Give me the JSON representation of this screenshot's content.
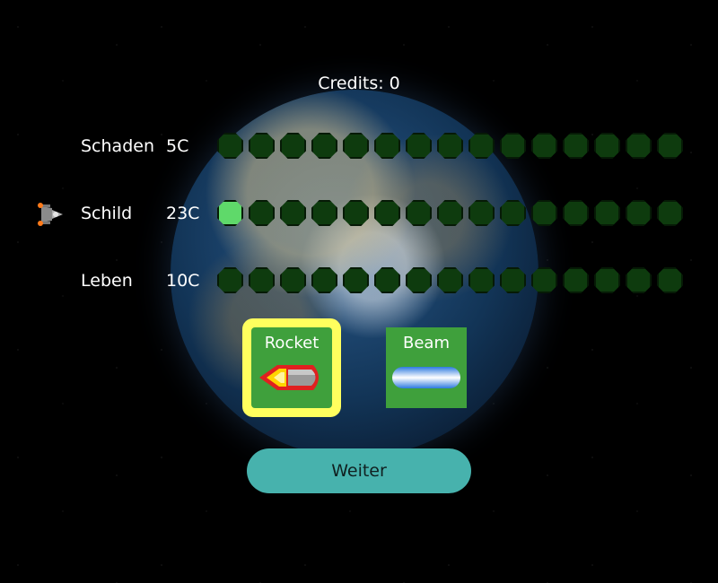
{
  "hud": {
    "credits_label": "Credits: 0"
  },
  "upgrades": [
    {
      "id": "schaden",
      "name": "Schaden",
      "cost": "5C",
      "level": 0,
      "max_level": 15
    },
    {
      "id": "schild",
      "name": "Schild",
      "cost": "23C",
      "level": 1,
      "max_level": 15
    },
    {
      "id": "leben",
      "name": "Leben",
      "cost": "10C",
      "level": 0,
      "max_level": 15
    }
  ],
  "weapons": [
    {
      "id": "rocket",
      "label": "Rocket",
      "icon": "rocket-icon",
      "selected": true
    },
    {
      "id": "beam",
      "label": "Beam",
      "icon": "beam-icon",
      "selected": false
    }
  ],
  "actions": {
    "continue_label": "Weiter"
  },
  "colors": {
    "slot_empty": "#0e3b0e",
    "slot_filled": "#5fd96a",
    "weapon_bg": "#3fa03c",
    "weapon_selected_border": "#ffff5e",
    "continue_button": "#47b2ad"
  }
}
